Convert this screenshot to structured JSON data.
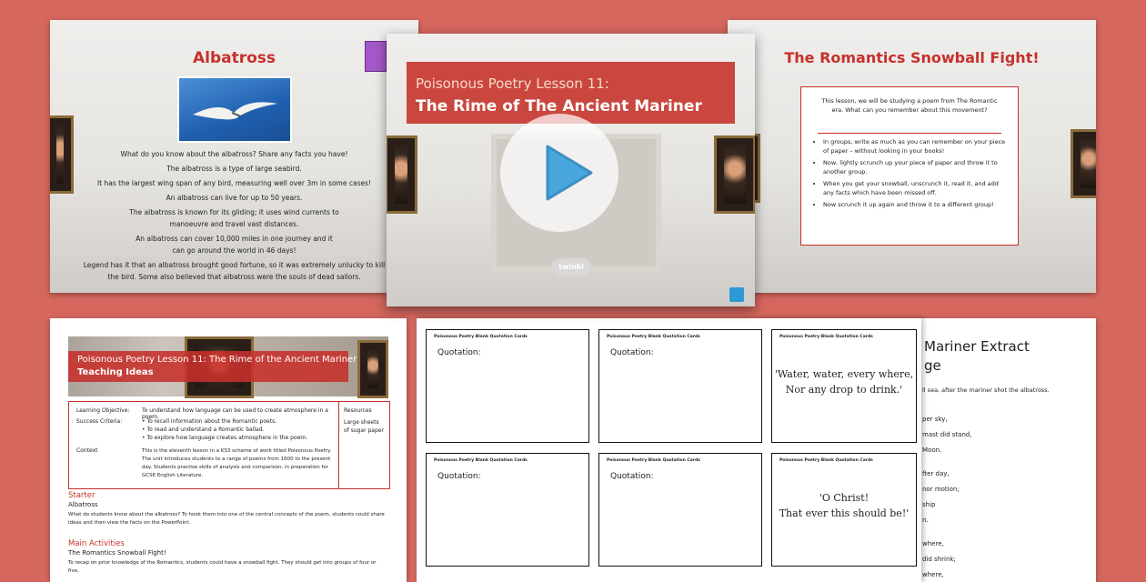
{
  "slide1": {
    "title": "Albatross",
    "lines": [
      "What do you know about the albatross? Share any facts you have!",
      "The albatross is a type of large seabird.",
      "It has the largest wing span of any bird, measuring well over 3m in some cases!",
      "An albatross can live for up to 50 years.",
      "The albatross is known for its gliding; it uses wind currents to",
      "manoeuvre and travel vast distances.",
      "An albatross can cover 10,000 miles in one journey and it",
      "can go around the world in 46 days!",
      "Legend has it that an albatross brought good fortune, so it was extremely unlucky to kill",
      "the bird. Some also believed that albatross were the souls of dead sailors."
    ]
  },
  "slide2": {
    "subtitle": "Poisonous Poetry Lesson 11:",
    "title": "The Rime of The Ancient Mariner",
    "logo": "twinkl"
  },
  "slide3": {
    "title": "The Romantics Snowball Fight!",
    "intro": "This lesson, we will be studying a poem from The Romantic era. What can you remember about this movement?",
    "bullets": [
      "In groups, write as much as you can remember on your piece of paper – without looking in your books!",
      "Now, lightly scrunch up your piece of paper and throw it to another group.",
      "When you get your snowball, unscrunch it, read it, and add any facts which have been missed off.",
      "Now scrunch it up again and throw it to a different group!"
    ]
  },
  "doc": {
    "header_line1": "Poisonous Poetry Lesson 11: The Rime of the Ancient Mariner",
    "header_line2": "Teaching Ideas",
    "learning_objective_label": "Learning Objective:",
    "learning_objective": "To understand how language can be used to create atmosphere in a poem.",
    "success_label": "Success Criteria:",
    "success": [
      "To recall information about the Romantic poets.",
      "To read and understand a Romantic ballad.",
      "To explore how language creates atmosphere in the poem."
    ],
    "context_label": "Context",
    "context": "This is the eleventh lesson in a KS3 scheme of work titled Poisonous Poetry. The unit introduces students to a range of poems from 1600 to the present day. Students practise skills of analysis and comparison, in preparation for GCSE English Literature.",
    "resources_label": "Resources",
    "resources": "Large sheets of sugar paper",
    "starter_heading": "Starter",
    "starter_sub": "Albatross",
    "starter_text": "What do students know about the albatross? To hook them into one of the central concepts of the poem, students could share ideas and then view the facts on the PowerPoint.",
    "main_heading": "Main Activities",
    "main_sub": "The Romantics Snowball Fight!",
    "main_text": "To recap on prior knowledge of the Romantics, students could have a snowball fight. They should get into groups of four or five,"
  },
  "cards": {
    "header": "Poisonous Poetry Blank Quotation Cards",
    "quotation_label": "Quotation:",
    "quote1_line1": "'Water, water, every where,",
    "quote1_line2": "Nor any drop to drink.'",
    "quote2_line1": "'O Christ!",
    "quote2_line2": "That ever this should be!'"
  },
  "extract": {
    "title_line1": "Mariner Extract",
    "title_line2": "ge",
    "intro": "ll sea, after the mariner shot the albatross.",
    "lines": [
      "per sky,",
      "mast did stand,",
      "Moon.",
      "fter day,",
      " nor motion;",
      "ship",
      "n.",
      "where,",
      "did shrink;",
      "where,"
    ]
  },
  "colors": {
    "accent": "#c7302b",
    "background": "#d5675e"
  }
}
